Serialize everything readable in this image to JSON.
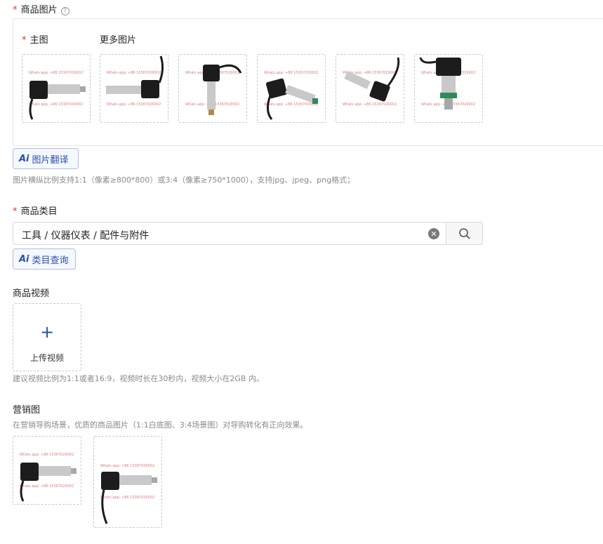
{
  "images_section": {
    "required_mark": "*",
    "title": "商品图片",
    "help_icon": "question-circle-icon",
    "main_label": "主图",
    "more_label": "更多图片",
    "watermark": "Whats app: +86 15367029002",
    "ai_translate_label": "图片翻译",
    "hint": "图片横纵比例支持1:1（像素≥800*800）或3:4（像素≥750*1000），支持jpg、jpeg、png格式；"
  },
  "category_section": {
    "required_mark": "*",
    "title": "商品类目",
    "value": "工具 / 仪器仪表 / 配件与附件",
    "clear_icon": "clear-circle-icon",
    "search_icon": "search-icon",
    "ai_query_label": "类目查询"
  },
  "video_section": {
    "title": "商品视频",
    "upload_label": "上传视频",
    "hint": "建议视频比例为1:1或者16:9，视频时长在30秒内，视频大小在2GB 内。"
  },
  "marketing_section": {
    "title": "营销图",
    "hint": "在营销导购场景，优质的商品图片（1:1白底图、3:4场景图）对导购转化有正向效果。"
  },
  "colors": {
    "accent": "#2b4fa8",
    "required": "#e0302a",
    "watermark": "#e07a7a"
  }
}
